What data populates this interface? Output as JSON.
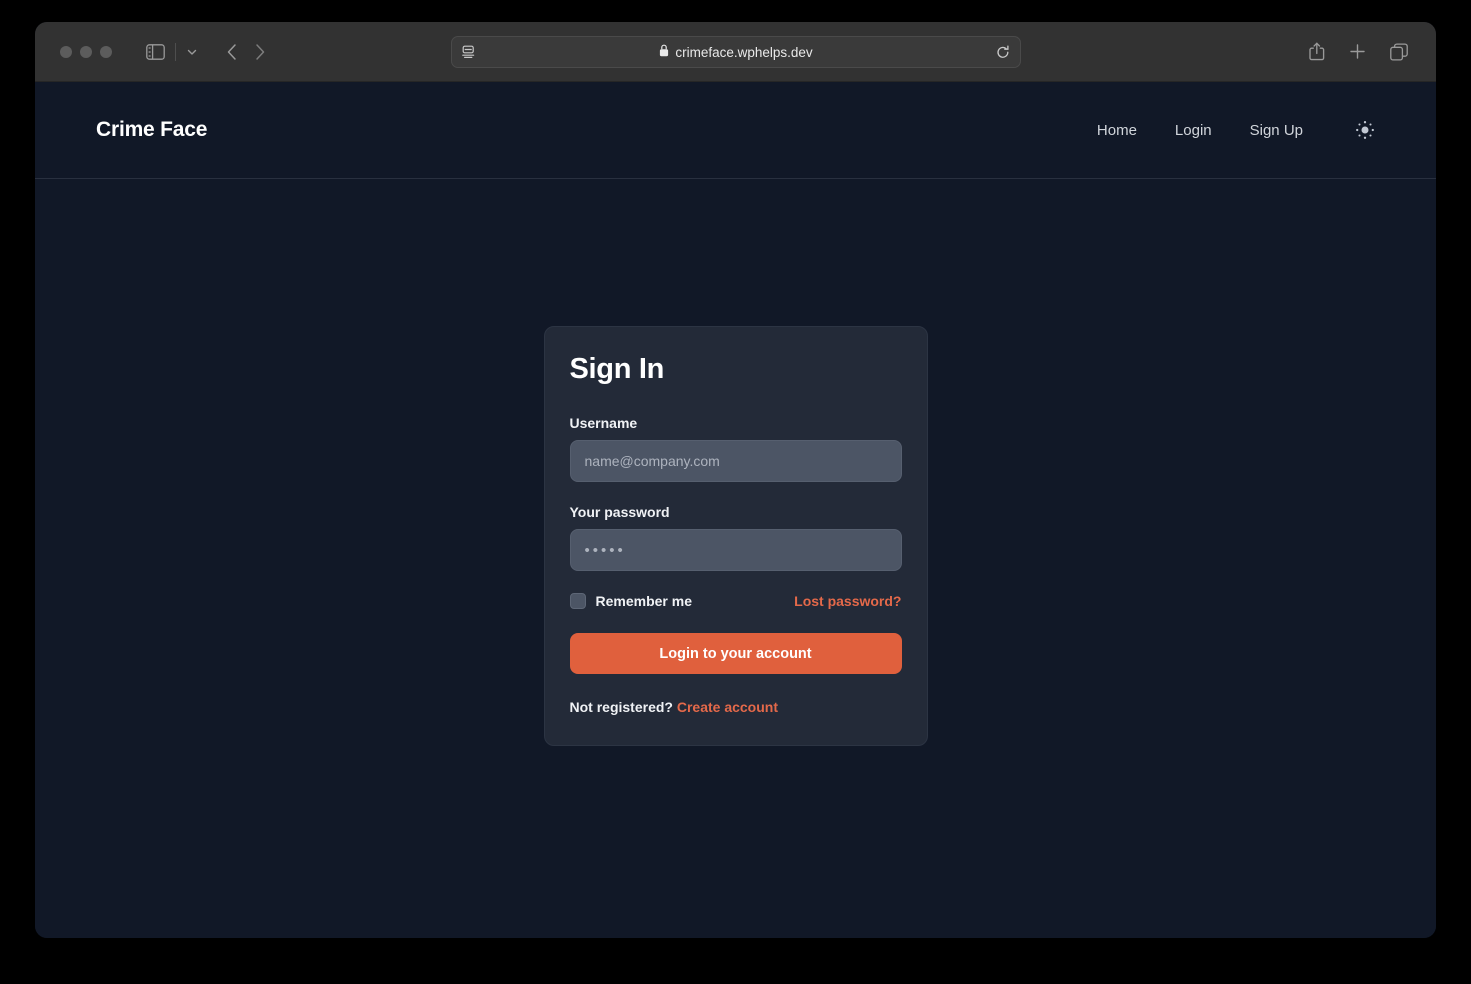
{
  "browser": {
    "url": "crimeface.wphelps.dev",
    "lock_icon": "lock-icon",
    "reader_icon": "reader-mode-icon",
    "reload_icon": "reload-icon",
    "sidebar_icon": "sidebar-toggle-icon",
    "sidebar_chevron_icon": "chevron-down-icon",
    "back_icon": "back-arrow-icon",
    "forward_icon": "forward-arrow-icon",
    "share_icon": "share-icon",
    "new_tab_icon": "plus-icon",
    "tab_overview_icon": "tab-overview-icon",
    "traffic_light_color": "#5c5c5c",
    "toolbar_color": "#323232"
  },
  "site": {
    "logo": "Crime Face",
    "nav": [
      {
        "label": "Home"
      },
      {
        "label": "Login"
      },
      {
        "label": "Sign Up"
      }
    ],
    "theme_toggle_icon": "sun-icon"
  },
  "signin": {
    "title": "Sign In",
    "username_label": "Username",
    "username_value": "",
    "username_placeholder": "name@company.com",
    "password_label": "Your password",
    "password_value": "",
    "password_placeholder": "•••••",
    "remember_label": "Remember me",
    "remember_checked": false,
    "lost_password_label": "Lost password?",
    "login_button_label": "Login to your account",
    "register_prompt": "Not registered?",
    "create_account_label": "Create account"
  },
  "colors": {
    "page_background": "#111827",
    "card_background": "#232a38",
    "input_background": "#4c5565",
    "accent": "#e0603d",
    "link_accent": "#e4694a"
  }
}
